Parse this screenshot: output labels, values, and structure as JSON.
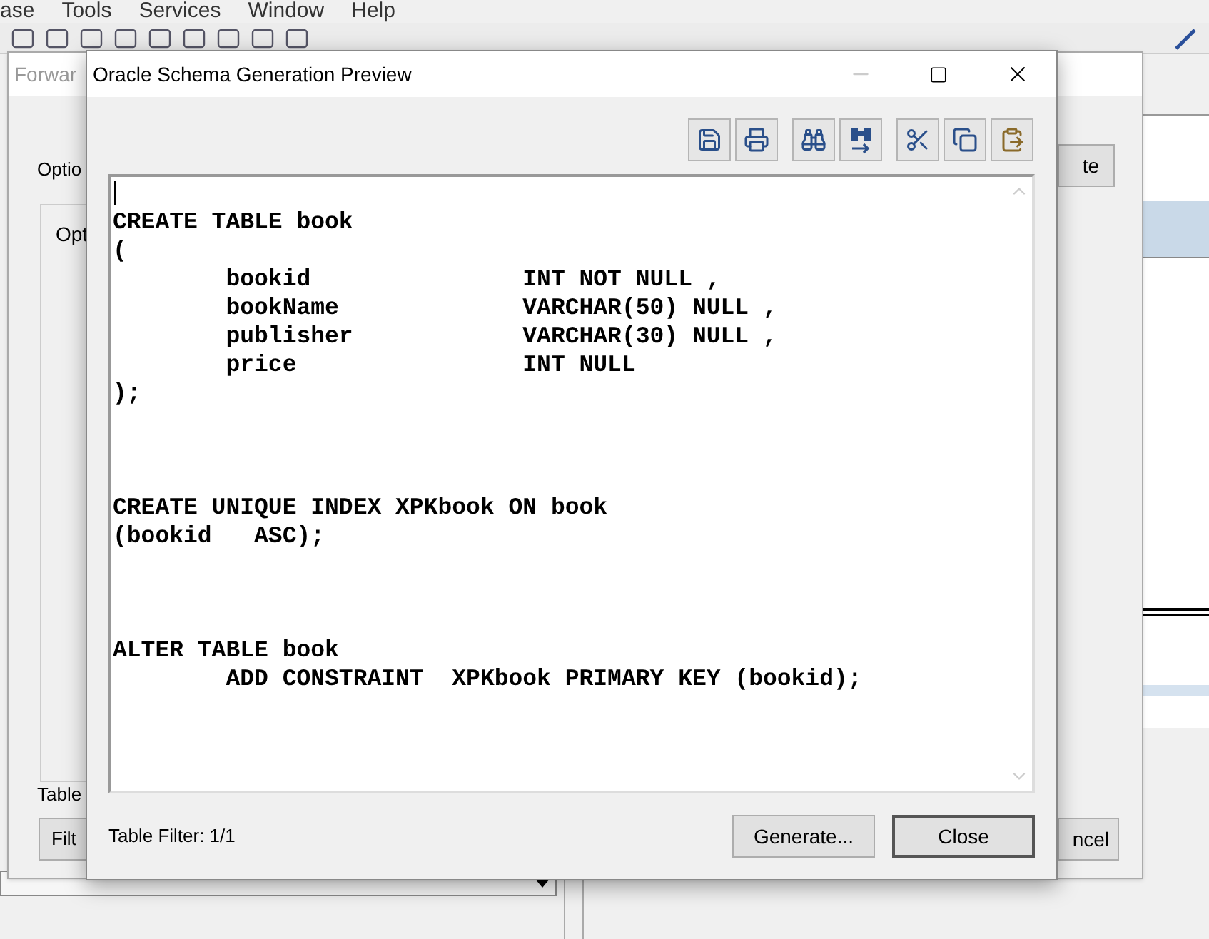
{
  "menu_bar": [
    "ase",
    "Tools",
    "Services",
    "Window",
    "Help"
  ],
  "background_dialog": {
    "title": "Forwar",
    "options_label": "Optio",
    "options_group": "Opt",
    "right_button": "te",
    "table_label": "Table",
    "filter_button": "Filt",
    "cancel_button": "ncel"
  },
  "preview_dialog": {
    "title": "Oracle Schema Generation Preview",
    "toolbar": [
      {
        "kind": "save"
      },
      {
        "kind": "print"
      },
      {
        "kind": "find"
      },
      {
        "kind": "replace"
      },
      {
        "kind": "cut"
      },
      {
        "kind": "copy"
      },
      {
        "kind": "paste"
      }
    ],
    "code": "CREATE TABLE book\n(\n        bookid               INT NOT NULL ,\n        bookName             VARCHAR(50) NULL ,\n        publisher            VARCHAR(30) NULL ,\n        price                INT NULL\n);\n\n\n\nCREATE UNIQUE INDEX XPKbook ON book\n(bookid   ASC);\n\n\n\nALTER TABLE book\n        ADD CONSTRAINT  XPKbook PRIMARY KEY (bookid);",
    "status": "Table Filter: 1/1",
    "buttons": [
      "Generate...",
      "Close"
    ]
  }
}
